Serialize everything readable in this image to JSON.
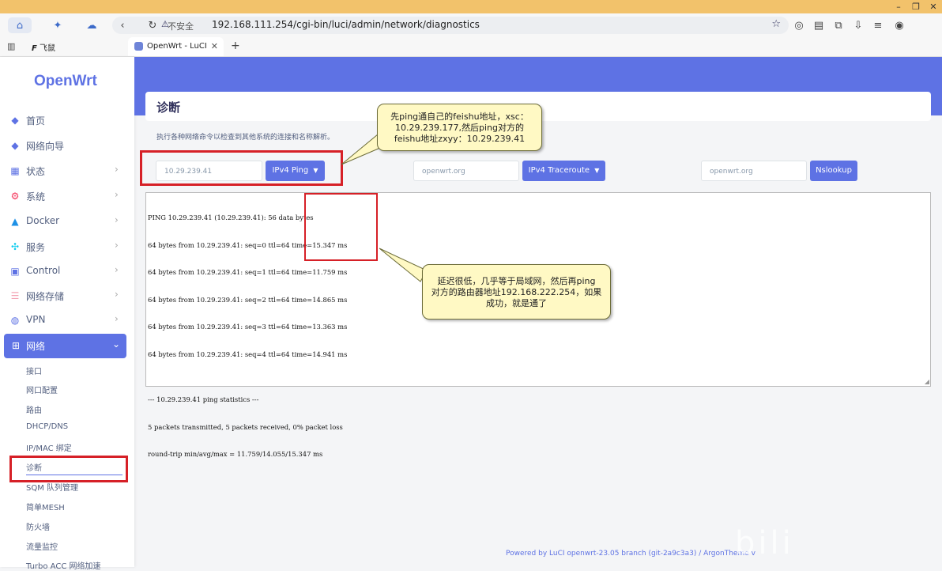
{
  "browser": {
    "url": "192.168.111.254/cgi-bin/luci/admin/network/diagnostics",
    "security_label": "不安全",
    "bookmark_label": "飞鼠",
    "tab_title": "OpenWrt - LuCI",
    "new_tab_symbol": "+",
    "tab_close_symbol": "✕"
  },
  "sidebar": {
    "logo": "OpenWrt",
    "menu": [
      {
        "label": "首页",
        "icon": "cube-icon"
      },
      {
        "label": "网络向导",
        "icon": "cube-icon"
      },
      {
        "label": "状态",
        "icon": "grid-icon"
      },
      {
        "label": "系统",
        "icon": "gear-icon"
      },
      {
        "label": "Docker",
        "icon": "docker-icon"
      },
      {
        "label": "服务",
        "icon": "puzzle-icon"
      },
      {
        "label": "Control",
        "icon": "window-icon"
      },
      {
        "label": "网络存储",
        "icon": "database-icon"
      },
      {
        "label": "VPN",
        "icon": "globe-icon"
      },
      {
        "label": "网络",
        "icon": "network-icon"
      }
    ],
    "submenu": [
      "接口",
      "网口配置",
      "路由",
      "DHCP/DNS",
      "IP/MAC 绑定",
      "诊断",
      "SQM 队列管理",
      "简单MESH",
      "防火墙",
      "流量监控",
      "Turbo ACC 网络加速"
    ]
  },
  "main": {
    "title": "诊断",
    "description": "执行各种网络命令以检查到其他系统的连接和名称解析。",
    "ping_input": "10.29.239.41",
    "ping_button": "IPv4 Ping",
    "traceroute_input": "openwrt.org",
    "traceroute_button": "IPv4 Traceroute",
    "nslookup_input": "openwrt.org",
    "nslookup_button": "Nslookup",
    "output_lines": [
      "PING 10.29.239.41 (10.29.239.41): 56 data bytes",
      "64 bytes from 10.29.239.41: seq=0 ttl=64 time=15.347 ms",
      "64 bytes from 10.29.239.41: seq=1 ttl=64 time=11.759 ms",
      "64 bytes from 10.29.239.41: seq=2 ttl=64 time=14.865 ms",
      "64 bytes from 10.29.239.41: seq=3 ttl=64 time=13.363 ms",
      "64 bytes from 10.29.239.41: seq=4 ttl=64 time=14.941 ms",
      "",
      "--- 10.29.239.41 ping statistics ---",
      "5 packets transmitted, 5 packets received, 0% packet loss",
      "round-trip min/avg/max = 11.759/14.055/15.347 ms"
    ],
    "footer": "Powered by LuCI openwrt-23.05 branch (git-2a9c3a3) / ArgonTheme v"
  },
  "annotations": {
    "callout1": [
      "先ping通自己的feishu地址，xsc：",
      "10.29.239.177,然后ping对方的",
      "feishu地址zxyy：10.29.239.41"
    ],
    "callout2": [
      "延迟很低，几乎等于局域网，然后再ping",
      "对方的路由器地址192.168.222.254，如果",
      "成功，就是通了"
    ]
  },
  "colors": {
    "accent": "#5e72e4",
    "annotation_red": "#d62027",
    "callout_bg": "#fff9c4",
    "titlebar": "#f2c26b"
  }
}
